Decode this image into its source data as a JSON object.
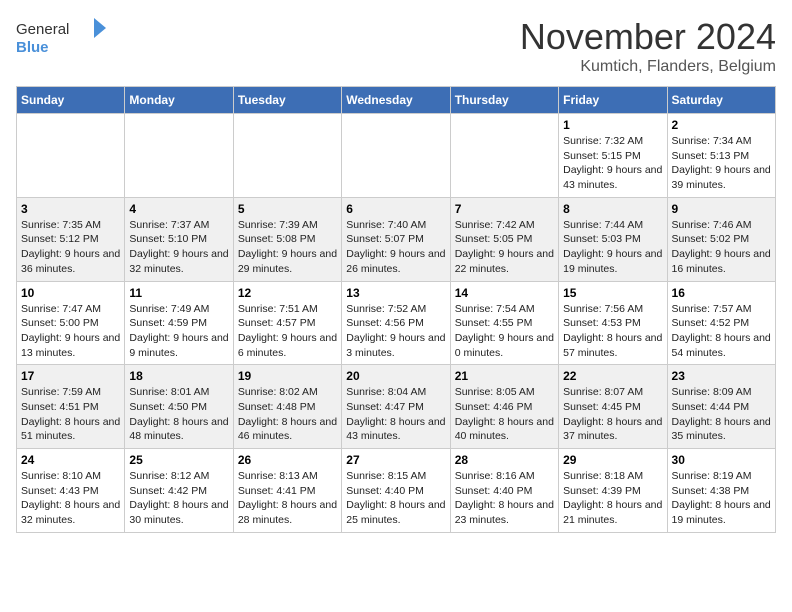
{
  "logo": {
    "text_general": "General",
    "text_blue": "Blue",
    "icon": "▶"
  },
  "title": "November 2024",
  "subtitle": "Kumtich, Flanders, Belgium",
  "weekdays": [
    "Sunday",
    "Monday",
    "Tuesday",
    "Wednesday",
    "Thursday",
    "Friday",
    "Saturday"
  ],
  "weeks": [
    [
      {
        "day": "",
        "info": ""
      },
      {
        "day": "",
        "info": ""
      },
      {
        "day": "",
        "info": ""
      },
      {
        "day": "",
        "info": ""
      },
      {
        "day": "",
        "info": ""
      },
      {
        "day": "1",
        "info": "Sunrise: 7:32 AM\nSunset: 5:15 PM\nDaylight: 9 hours and 43 minutes."
      },
      {
        "day": "2",
        "info": "Sunrise: 7:34 AM\nSunset: 5:13 PM\nDaylight: 9 hours and 39 minutes."
      }
    ],
    [
      {
        "day": "3",
        "info": "Sunrise: 7:35 AM\nSunset: 5:12 PM\nDaylight: 9 hours and 36 minutes."
      },
      {
        "day": "4",
        "info": "Sunrise: 7:37 AM\nSunset: 5:10 PM\nDaylight: 9 hours and 32 minutes."
      },
      {
        "day": "5",
        "info": "Sunrise: 7:39 AM\nSunset: 5:08 PM\nDaylight: 9 hours and 29 minutes."
      },
      {
        "day": "6",
        "info": "Sunrise: 7:40 AM\nSunset: 5:07 PM\nDaylight: 9 hours and 26 minutes."
      },
      {
        "day": "7",
        "info": "Sunrise: 7:42 AM\nSunset: 5:05 PM\nDaylight: 9 hours and 22 minutes."
      },
      {
        "day": "8",
        "info": "Sunrise: 7:44 AM\nSunset: 5:03 PM\nDaylight: 9 hours and 19 minutes."
      },
      {
        "day": "9",
        "info": "Sunrise: 7:46 AM\nSunset: 5:02 PM\nDaylight: 9 hours and 16 minutes."
      }
    ],
    [
      {
        "day": "10",
        "info": "Sunrise: 7:47 AM\nSunset: 5:00 PM\nDaylight: 9 hours and 13 minutes."
      },
      {
        "day": "11",
        "info": "Sunrise: 7:49 AM\nSunset: 4:59 PM\nDaylight: 9 hours and 9 minutes."
      },
      {
        "day": "12",
        "info": "Sunrise: 7:51 AM\nSunset: 4:57 PM\nDaylight: 9 hours and 6 minutes."
      },
      {
        "day": "13",
        "info": "Sunrise: 7:52 AM\nSunset: 4:56 PM\nDaylight: 9 hours and 3 minutes."
      },
      {
        "day": "14",
        "info": "Sunrise: 7:54 AM\nSunset: 4:55 PM\nDaylight: 9 hours and 0 minutes."
      },
      {
        "day": "15",
        "info": "Sunrise: 7:56 AM\nSunset: 4:53 PM\nDaylight: 8 hours and 57 minutes."
      },
      {
        "day": "16",
        "info": "Sunrise: 7:57 AM\nSunset: 4:52 PM\nDaylight: 8 hours and 54 minutes."
      }
    ],
    [
      {
        "day": "17",
        "info": "Sunrise: 7:59 AM\nSunset: 4:51 PM\nDaylight: 8 hours and 51 minutes."
      },
      {
        "day": "18",
        "info": "Sunrise: 8:01 AM\nSunset: 4:50 PM\nDaylight: 8 hours and 48 minutes."
      },
      {
        "day": "19",
        "info": "Sunrise: 8:02 AM\nSunset: 4:48 PM\nDaylight: 8 hours and 46 minutes."
      },
      {
        "day": "20",
        "info": "Sunrise: 8:04 AM\nSunset: 4:47 PM\nDaylight: 8 hours and 43 minutes."
      },
      {
        "day": "21",
        "info": "Sunrise: 8:05 AM\nSunset: 4:46 PM\nDaylight: 8 hours and 40 minutes."
      },
      {
        "day": "22",
        "info": "Sunrise: 8:07 AM\nSunset: 4:45 PM\nDaylight: 8 hours and 37 minutes."
      },
      {
        "day": "23",
        "info": "Sunrise: 8:09 AM\nSunset: 4:44 PM\nDaylight: 8 hours and 35 minutes."
      }
    ],
    [
      {
        "day": "24",
        "info": "Sunrise: 8:10 AM\nSunset: 4:43 PM\nDaylight: 8 hours and 32 minutes."
      },
      {
        "day": "25",
        "info": "Sunrise: 8:12 AM\nSunset: 4:42 PM\nDaylight: 8 hours and 30 minutes."
      },
      {
        "day": "26",
        "info": "Sunrise: 8:13 AM\nSunset: 4:41 PM\nDaylight: 8 hours and 28 minutes."
      },
      {
        "day": "27",
        "info": "Sunrise: 8:15 AM\nSunset: 4:40 PM\nDaylight: 8 hours and 25 minutes."
      },
      {
        "day": "28",
        "info": "Sunrise: 8:16 AM\nSunset: 4:40 PM\nDaylight: 8 hours and 23 minutes."
      },
      {
        "day": "29",
        "info": "Sunrise: 8:18 AM\nSunset: 4:39 PM\nDaylight: 8 hours and 21 minutes."
      },
      {
        "day": "30",
        "info": "Sunrise: 8:19 AM\nSunset: 4:38 PM\nDaylight: 8 hours and 19 minutes."
      }
    ]
  ]
}
